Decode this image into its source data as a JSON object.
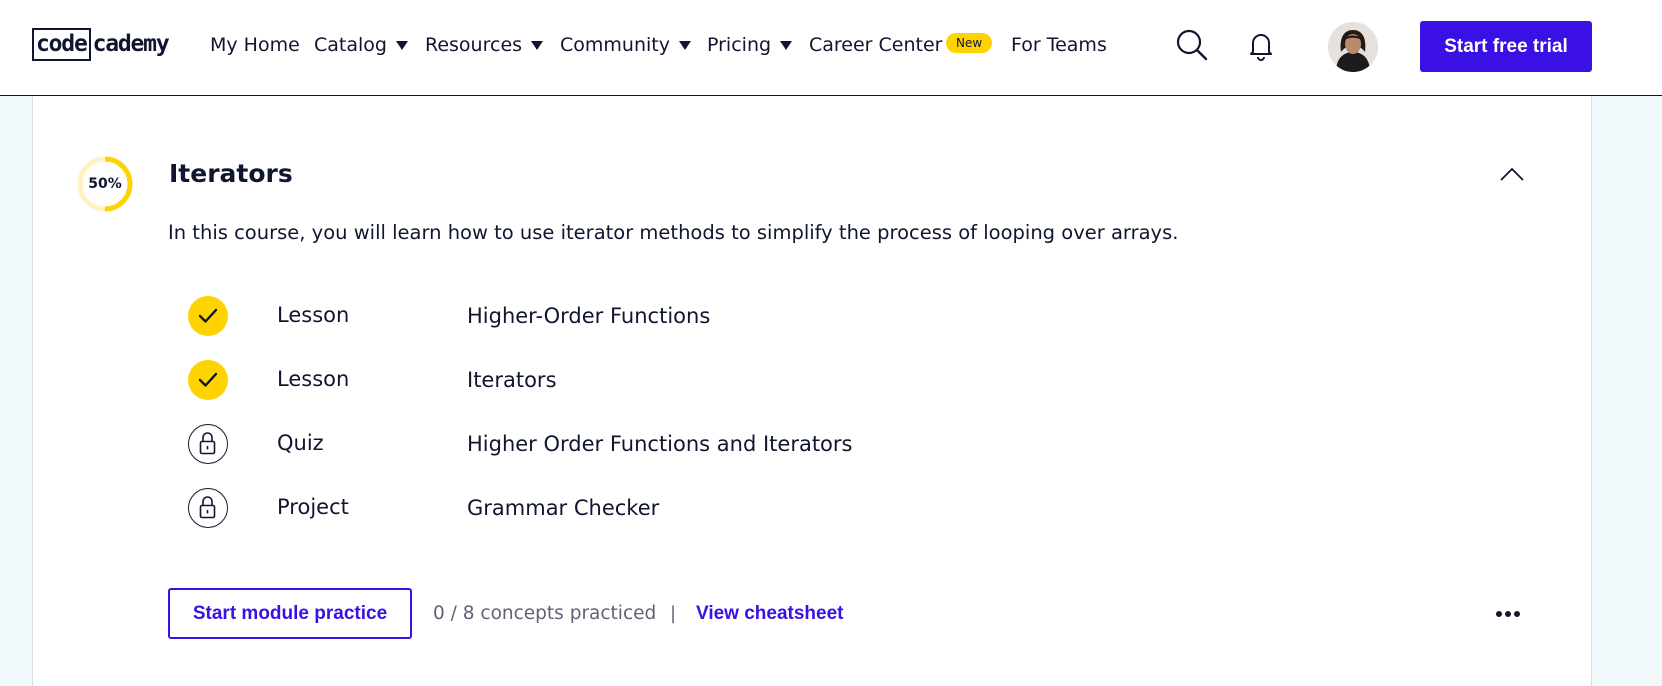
{
  "header": {
    "logo": {
      "boxed": "code",
      "rest": "cademy"
    },
    "nav": [
      {
        "label": "My Home",
        "has_dropdown": false
      },
      {
        "label": "Catalog",
        "has_dropdown": true
      },
      {
        "label": "Resources",
        "has_dropdown": true
      },
      {
        "label": "Community",
        "has_dropdown": true
      },
      {
        "label": "Pricing",
        "has_dropdown": true
      },
      {
        "label": "Career Center",
        "has_dropdown": false,
        "badge": "New"
      },
      {
        "label": "For Teams",
        "has_dropdown": false
      }
    ],
    "icons": {
      "search": "search-icon",
      "notifications": "bell-icon"
    },
    "cta_label": "Start free trial",
    "colors": {
      "brand": "#3a10e5",
      "badge": "#ffd300",
      "ink": "#10162f"
    }
  },
  "module": {
    "progress_label": "50%",
    "progress_fraction": 0.5,
    "title": "Iterators",
    "description": "In this course, you will learn how to use iterator methods to simplify the process of looping over arrays.",
    "items": [
      {
        "type": "Lesson",
        "title": "Higher-Order Functions",
        "status": "completed",
        "icon": "check-icon"
      },
      {
        "type": "Lesson",
        "title": "Iterators",
        "status": "completed",
        "icon": "check-icon"
      },
      {
        "type": "Quiz",
        "title": "Higher Order Functions and Iterators",
        "status": "locked",
        "icon": "lock-icon"
      },
      {
        "type": "Project",
        "title": "Grammar Checker",
        "status": "locked",
        "icon": "lock-icon"
      }
    ],
    "practice_button": "Start module practice",
    "concepts_practiced": "0 / 8 concepts practiced",
    "separator": "|",
    "cheatsheet_link": "View cheatsheet",
    "colors": {
      "progress": "#ffd300",
      "progress_track": "#fff3c2",
      "muted_text": "#5f6378"
    }
  }
}
